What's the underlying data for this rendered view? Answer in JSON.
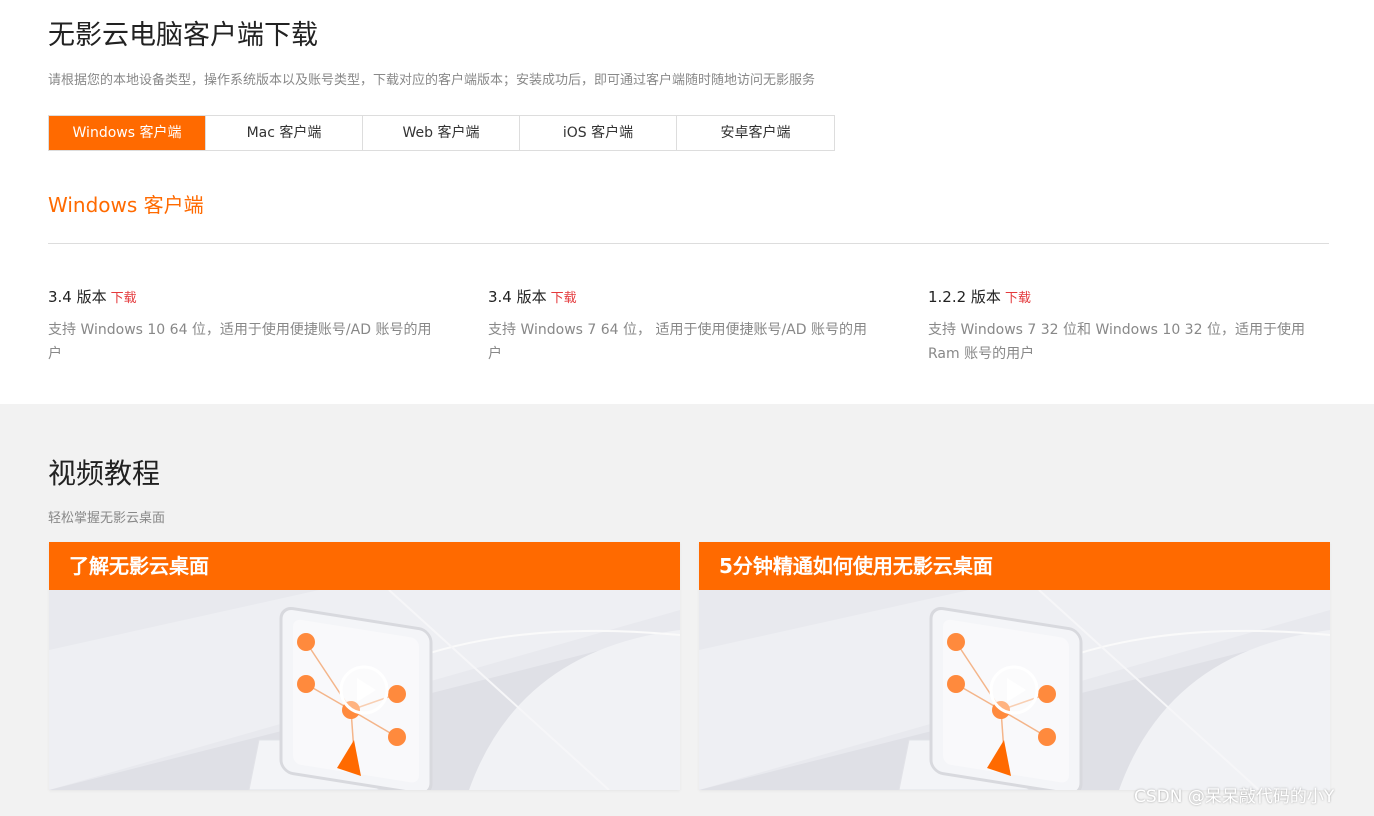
{
  "header": {
    "title": "无影云电脑客户端下载",
    "description": "请根据您的本地设备类型，操作系统版本以及账号类型，下载对应的客户端版本；安装成功后，即可通过客户端随时随地访问无影服务"
  },
  "tabs": [
    {
      "label": "Windows 客户端",
      "active": true
    },
    {
      "label": "Mac 客户端",
      "active": false
    },
    {
      "label": "Web 客户端",
      "active": false
    },
    {
      "label": "iOS 客户端",
      "active": false
    },
    {
      "label": "安卓客户端",
      "active": false
    }
  ],
  "section": {
    "title": "Windows 客户端"
  },
  "versions": [
    {
      "version": "3.4 版本",
      "download_label": "下载",
      "description": "支持 Windows 10 64 位，适用于使用便捷账号/AD 账号的用户"
    },
    {
      "version": "3.4 版本",
      "download_label": "下载",
      "description": "支持 Windows 7 64 位， 适用于使用便捷账号/AD 账号的用户"
    },
    {
      "version": "1.2.2 版本",
      "download_label": "下载",
      "description": "支持 Windows 7 32 位和 Windows 10 32 位，适用于使用 Ram 账号的用户"
    }
  ],
  "video_section": {
    "title": "视频教程",
    "subtitle": "轻松掌握无影云桌面",
    "cards": [
      {
        "title": "了解无影云桌面"
      },
      {
        "title": "5分钟精通如何使用无影云桌面"
      }
    ]
  },
  "watermark": "CSDN @呆呆敲代码的小Y",
  "colors": {
    "accent": "#ff6a00",
    "download": "#e4393c",
    "bottom_bg": "#f2f2f2"
  }
}
